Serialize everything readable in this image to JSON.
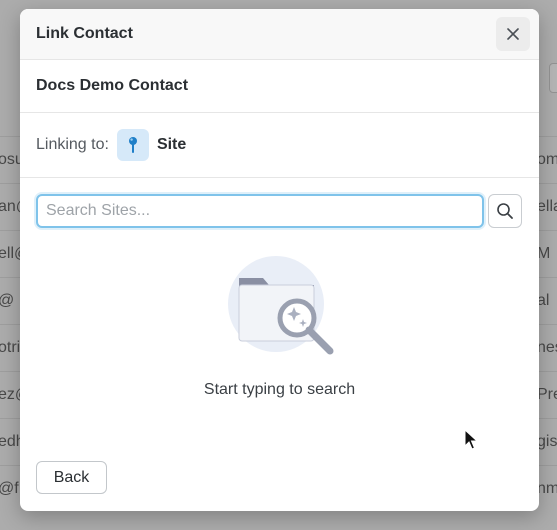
{
  "background": {
    "rows": [
      {
        "left": "osu",
        "right": "om"
      },
      {
        "left": "an@",
        "right": "ella"
      },
      {
        "left": "ell@",
        "right": "M"
      },
      {
        "left": "@",
        "right": "al"
      },
      {
        "left": "otri",
        "right": "nes"
      },
      {
        "left": "ez@",
        "right": "Pre"
      },
      {
        "left": "edh",
        "right": "gis"
      },
      {
        "left": "@f",
        "right": "nm"
      }
    ]
  },
  "modal": {
    "title": "Link Contact",
    "contact_name": "Docs Demo Contact",
    "linking_label": "Linking to:",
    "linking_value": "Site",
    "linking_icon": "map-pin-icon",
    "search": {
      "placeholder": "Search Sites...",
      "value": ""
    },
    "empty_state_text": "Start typing to search",
    "back_label": "Back"
  },
  "colors": {
    "accent_focus": "#7fc3ea",
    "pin_icon": "#1f7fc8",
    "pin_bg": "#d6e9f9"
  }
}
